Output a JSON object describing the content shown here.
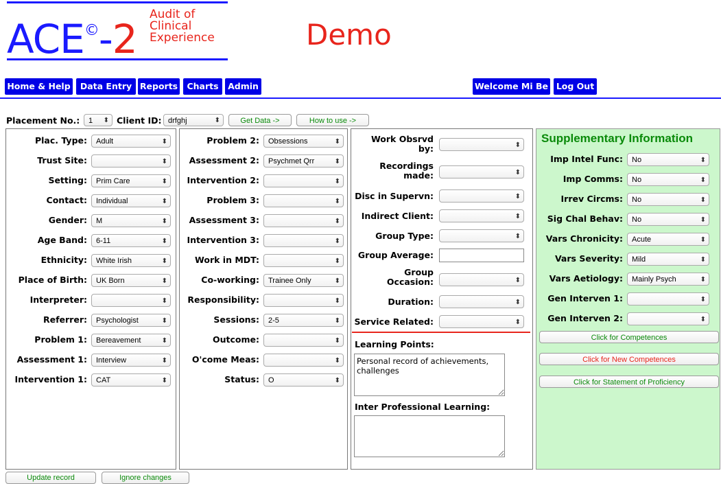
{
  "header": {
    "logo_text": "ACE",
    "logo_copyright": "©",
    "logo_dash": "-",
    "logo_number": "2",
    "logo_sub": [
      "Audit of",
      "Clinical",
      "Experience"
    ],
    "demo_label": "Demo"
  },
  "nav": {
    "items": [
      "Home & Help",
      "Data Entry",
      "Reports",
      "Charts",
      "Admin"
    ],
    "welcome": "Welcome Mi Be",
    "logout": "Log Out"
  },
  "filters": {
    "placement_label": "Placement No.:",
    "placement_value": "1",
    "client_label": "Client ID:",
    "client_value": "drfghj",
    "get_data": "Get Data ->",
    "how_to_use": "How to use ->"
  },
  "col1": [
    {
      "label": "Plac. Type:",
      "value": "Adult"
    },
    {
      "label": "Trust Site:",
      "value": ""
    },
    {
      "label": "Setting:",
      "value": "Prim Care"
    },
    {
      "label": "Contact:",
      "value": "Individual"
    },
    {
      "label": "Gender:",
      "value": "M"
    },
    {
      "label": "Age Band:",
      "value": "6-11"
    },
    {
      "label": "Ethnicity:",
      "value": "White Irish"
    },
    {
      "label": "Place of Birth:",
      "value": "UK Born"
    },
    {
      "label": "Interpreter:",
      "value": ""
    },
    {
      "label": "Referrer:",
      "value": "Psychologist"
    },
    {
      "label": "Problem 1:",
      "value": "Bereavement"
    },
    {
      "label": "Assessment 1:",
      "value": "Interview"
    },
    {
      "label": "Intervention 1:",
      "value": "CAT"
    }
  ],
  "col2": [
    {
      "label": "Problem 2:",
      "value": "Obsessions"
    },
    {
      "label": "Assessment 2:",
      "value": "Psychmet Qrr"
    },
    {
      "label": "Intervention 2:",
      "value": ""
    },
    {
      "label": "Problem 3:",
      "value": ""
    },
    {
      "label": "Assessment 3:",
      "value": ""
    },
    {
      "label": "Intervention 3:",
      "value": ""
    },
    {
      "label": "Work in MDT:",
      "value": ""
    },
    {
      "label": "Co-working:",
      "value": "Trainee Only"
    },
    {
      "label": "Responsibility:",
      "value": ""
    },
    {
      "label": "Sessions:",
      "value": "2-5"
    },
    {
      "label": "Outcome:",
      "value": ""
    },
    {
      "label": "O'come Meas:",
      "value": ""
    },
    {
      "label": "Status:",
      "value": "O"
    }
  ],
  "col3": {
    "work_observed": {
      "line1": "Work Obsrvd",
      "line2": "by:",
      "value": ""
    },
    "recordings": {
      "line1": "Recordings",
      "line2": "made:",
      "value": ""
    },
    "disc_in_supervn": {
      "label": "Disc in Supervn:",
      "value": ""
    },
    "indirect_client": {
      "label": "Indirect Client:",
      "value": ""
    },
    "group_type": {
      "label": "Group Type:",
      "value": ""
    },
    "group_average": {
      "label": "Group Average:",
      "value": ""
    },
    "group_occasion": {
      "line1": "Group",
      "line2": "Occasion:",
      "value": ""
    },
    "duration": {
      "label": "Duration:",
      "value": ""
    },
    "service_related": {
      "label": "Service Related:",
      "value": ""
    },
    "learning_points_label": "Learning Points:",
    "learning_points_value": "Personal record of achievements, challenges",
    "ipl_label": "Inter Professional Learning:",
    "ipl_value": ""
  },
  "supp": {
    "title": "Supplementary Information",
    "rows": [
      {
        "label": "Imp Intel Func:",
        "value": "No"
      },
      {
        "label": "Imp Comms:",
        "value": "No"
      },
      {
        "label": "Irrev Circms:",
        "value": "No"
      },
      {
        "label": "Sig Chal Behav:",
        "value": "No"
      },
      {
        "label": "Vars Chronicity:",
        "value": "Acute"
      },
      {
        "label": "Vars Severity:",
        "value": "Mild"
      },
      {
        "label": "Vars Aetiology:",
        "value": "Mainly Psych"
      },
      {
        "label": "Gen Interven 1:",
        "value": ""
      },
      {
        "label": "Gen Interven 2:",
        "value": ""
      }
    ],
    "btn_competences": "Click for Competences",
    "btn_new_competences": "Click for New Competences",
    "btn_statement": "Click for Statement of Proficiency"
  },
  "footer": {
    "update": "Update record",
    "ignore": "Ignore changes"
  },
  "colors": {
    "brand_blue": "#1a1aff",
    "nav_blue": "#0000e6",
    "brand_red": "#e8251c",
    "supp_green_bg": "#ccf7cc",
    "supp_green_text": "#0a8a0a"
  }
}
